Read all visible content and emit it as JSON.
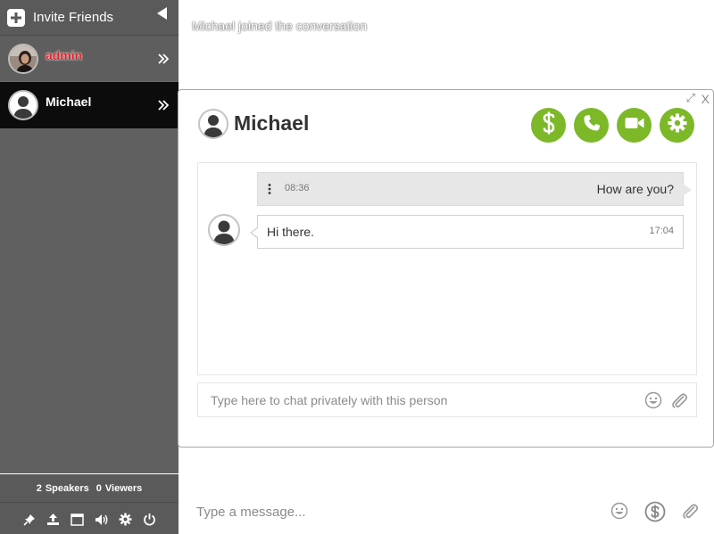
{
  "sidebar": {
    "invite_label": "Invite Friends",
    "users": [
      {
        "name": "admin",
        "name_color": "#e0232a"
      },
      {
        "name": "Michael",
        "name_color": "#ffffff"
      }
    ],
    "counts": {
      "speakers_num": "2",
      "speakers_label": "Speakers",
      "viewers_num": "0",
      "viewers_label": "Viewers"
    },
    "tool_icons": [
      "pin-icon",
      "upload-icon",
      "window-icon",
      "volume-icon",
      "gear-icon",
      "power-icon"
    ]
  },
  "system_message": "Michael joined the conversation",
  "private_chat": {
    "title": "Michael",
    "expand_symbol": "⤢",
    "close_symbol": "X",
    "accent_color": "#7cb828",
    "messages": [
      {
        "direction": "out",
        "time": "08:36",
        "text": "How are you?"
      },
      {
        "direction": "in",
        "time": "17:04",
        "text": "Hi there."
      }
    ],
    "input_placeholder": "Type here to chat privately with this person"
  },
  "main_input": {
    "placeholder": "Type a message..."
  }
}
